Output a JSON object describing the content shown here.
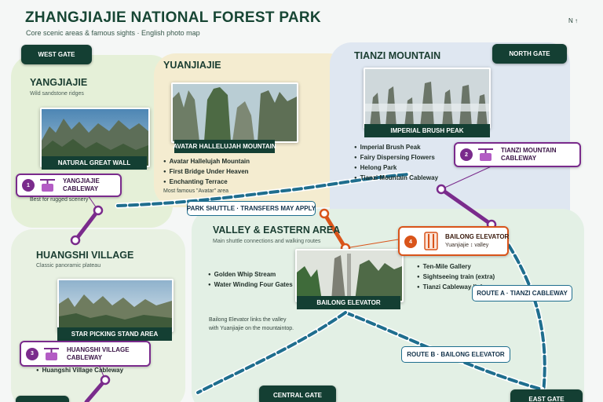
{
  "header": {
    "title": "ZHANGJIAJIE NATIONAL FOREST PARK",
    "subtitle": "Core scenic areas & famous sights · English photo map",
    "north": "N ↑"
  },
  "gates": {
    "west": "WEST GATE",
    "north": "NORTH GATE",
    "central": "CENTRAL GATE",
    "east": "EAST GATE"
  },
  "areas": {
    "yangjiajie": {
      "name": "YANGJIAJIE",
      "sub": "Wild sandstone ridges",
      "photo": "NATURAL GREAT WALL",
      "note": "Best for rugged scenery"
    },
    "yuanjiajie": {
      "name": "YUANJIAJIE",
      "photo": "AVATAR HALLELUJAH MOUNTAIN",
      "sights": [
        "Avatar Hallelujah Mountain",
        "First Bridge Under Heaven",
        "Enchanting Terrace"
      ],
      "note": "Most famous \"Avatar\" area"
    },
    "tianzi": {
      "name": "TIANZI MOUNTAIN",
      "photo": "IMPERIAL BRUSH PEAK",
      "sights": [
        "Imperial Brush Peak",
        "Fairy Dispersing Flowers",
        "Helong Park",
        "Tianzi Mountain Cableway"
      ]
    },
    "valley": {
      "name": "VALLEY & EASTERN AREA",
      "sub": "Main shuttle connections and walking routes",
      "photo": "BAILONG ELEVATOR",
      "sights_left": [
        "Golden Whip Stream",
        "Water Winding Four Gates"
      ],
      "sights_right": [
        "Ten-Mile Gallery",
        "Sightseeing train (extra)",
        "Tianzi Cableway link"
      ],
      "note_line1": "Bailong Elevator links the valley",
      "note_line2": "with Yuanjiajie on the mountaintop."
    },
    "huangshi": {
      "name": "HUANGSHI VILLAGE",
      "sub": "Classic panoramic plateau",
      "photo": "STAR PICKING STAND AREA",
      "sights": [
        "Huangshi Village Cableway"
      ]
    }
  },
  "cableways": [
    {
      "num": "1",
      "line1": "YANGJIAJIE",
      "line2": "CABLEWAY"
    },
    {
      "num": "2",
      "line1": "TIANZI MOUNTAIN",
      "line2": "CABLEWAY"
    },
    {
      "num": "3",
      "line1": "HUANGSHI VILLAGE",
      "line2": "CABLEWAY"
    }
  ],
  "elevator": {
    "num": "4",
    "line1": "BAILONG ELEVATOR",
    "line2": "Yuanjiajie ↕ valley"
  },
  "routes": {
    "shuttle": "PARK SHUTTLE · TRANSFERS MAY APPLY",
    "route_a": "ROUTE A · TIANZI CABLEWAY",
    "route_b": "ROUTE B · BAILONG ELEVATOR"
  },
  "colors": {
    "cableway": "#7a2b8c",
    "elevator": "#d9541a",
    "shuttle_route": "#1f6e8e",
    "label_bg": "#143f33"
  },
  "icons": {
    "cableway": "cable-car-icon",
    "elevator": "elevator-icon",
    "north_arrow": "north-arrow-icon"
  }
}
